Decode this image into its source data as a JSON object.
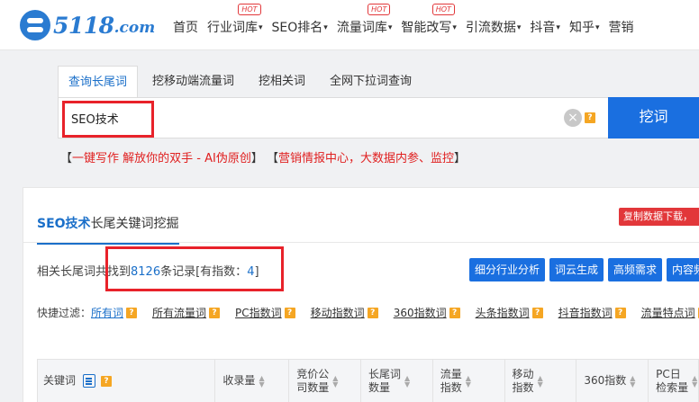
{
  "logo": {
    "text": "5118",
    "domain": ".com"
  },
  "nav": [
    {
      "label": "首页",
      "caret": false,
      "hot": false
    },
    {
      "label": "行业词库",
      "caret": true,
      "hot": true
    },
    {
      "label": "SEO排名",
      "caret": true,
      "hot": false
    },
    {
      "label": "流量词库",
      "caret": true,
      "hot": true
    },
    {
      "label": "智能改写",
      "caret": true,
      "hot": true
    },
    {
      "label": "引流数据",
      "caret": true,
      "hot": false
    },
    {
      "label": "抖音",
      "caret": true,
      "hot": false
    },
    {
      "label": "知乎",
      "caret": true,
      "hot": false
    },
    {
      "label": "营销",
      "caret": false,
      "hot": false
    }
  ],
  "hot_label": "HOT",
  "caret_glyph": "▾",
  "tabs": [
    "查询长尾词",
    "挖移动端流量词",
    "挖相关词",
    "全网下拉词查询"
  ],
  "search": {
    "value": "SEO技术",
    "clear_glyph": "×",
    "help": "?",
    "button": "挖词"
  },
  "promo": {
    "open1": "【",
    "text1": "一键写作 解放你的双手 - AI伪原创",
    "close1": "】",
    "open2": "【",
    "text2": "营销情报中心，大数据内参、监控",
    "close2": "】"
  },
  "panel": {
    "keyword": "SEO技术",
    "title_suffix": "长尾关键词挖掘",
    "copy_button": "复制数据下载，",
    "result_prefix": "相关长尾词共找到",
    "result_count": "8126",
    "result_mid": "条记录[有指数：",
    "result_index": "4",
    "result_suffix": "]",
    "actions": [
      "细分行业分析",
      "词云生成",
      "高频需求",
      "内容频"
    ],
    "filter_label": "快捷过滤：",
    "filters": [
      "所有词",
      "所有流量词",
      "PC指数词",
      "移动指数词",
      "360指数词",
      "头条指数词",
      "抖音指数词",
      "流量特点词"
    ],
    "columns": [
      {
        "label": "关键词",
        "width": 198
      },
      {
        "label": "收录量",
        "width": 82
      },
      {
        "label": "竞价公\n司数量",
        "width": 80
      },
      {
        "label": "长尾词\n数量",
        "width": 80
      },
      {
        "label": "流量\n指数",
        "width": 80
      },
      {
        "label": "移动\n指数",
        "width": 80
      },
      {
        "label": "360指数",
        "width": 80
      },
      {
        "label": "PC日\n检索量",
        "width": 56
      }
    ]
  },
  "colors": {
    "accent": "#1a6fe0",
    "highlight": "#e8222a",
    "hot": "#e2373a",
    "help": "#f5a623"
  }
}
